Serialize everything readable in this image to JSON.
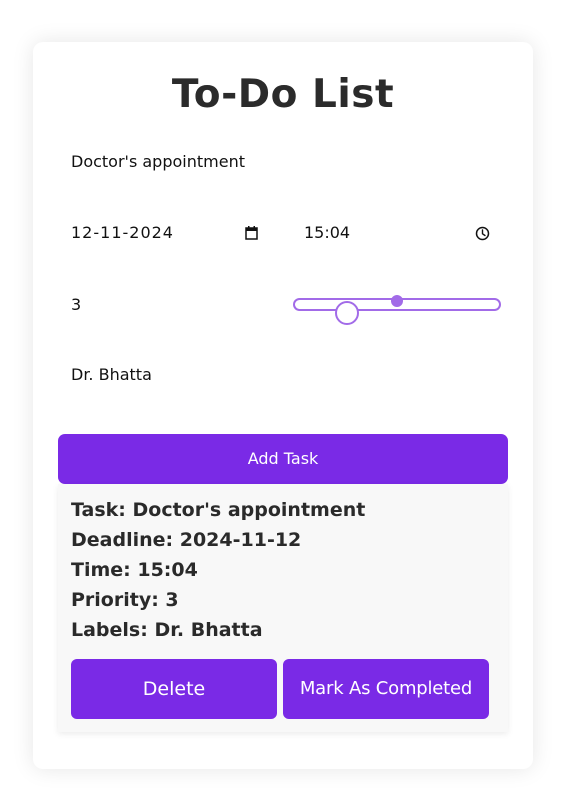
{
  "app": {
    "title": "To-Do List"
  },
  "form": {
    "task_name": "Doctor's appointment",
    "date_value": "12-11-2024",
    "time_value": "15:04",
    "priority_value": "3",
    "priority_slider_level": 3,
    "labels_value": "Dr. Bhatta",
    "add_button_label": "Add Task"
  },
  "task": {
    "task_line": "Task: Doctor's appointment",
    "deadline_line": "Deadline: 2024-11-12",
    "time_line": "Time: 15:04",
    "priority_line": "Priority: 3",
    "labels_line": "Labels: Dr. Bhatta",
    "delete_label": "Delete",
    "complete_label": "Mark As Completed"
  },
  "icons": {
    "date": "calendar-icon",
    "time": "clock-icon"
  },
  "colors": {
    "accent": "#7a2ae6",
    "slider": "#a26be8"
  }
}
